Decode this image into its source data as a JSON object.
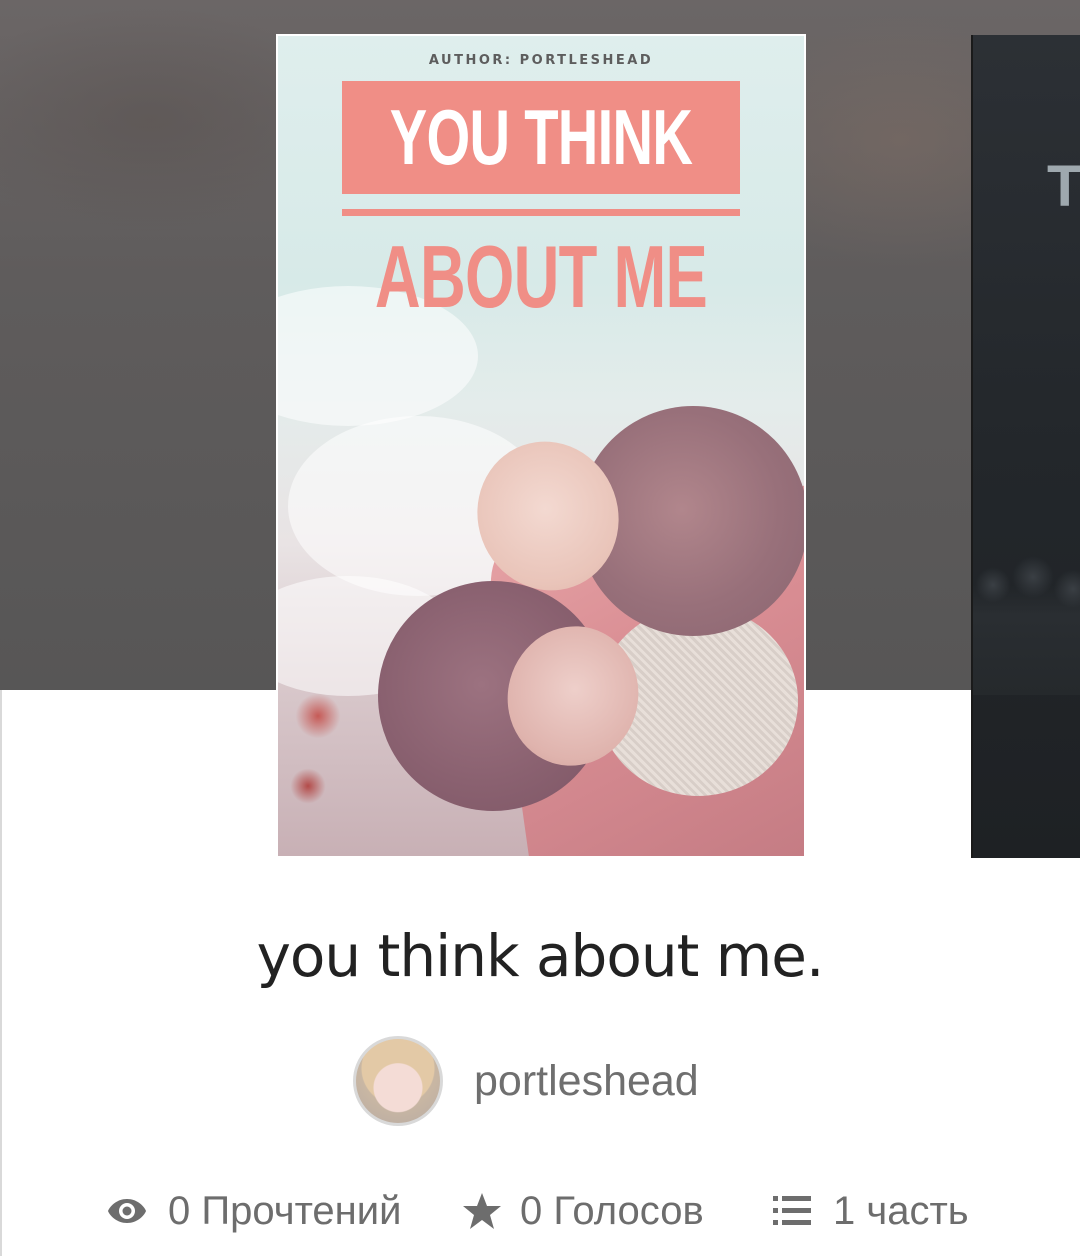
{
  "cover": {
    "author_line": "AUTHOR: PORTLESHEAD",
    "title_line1": "YOU THINK",
    "title_line2": "ABOUT ME",
    "next_cover_letter": "T"
  },
  "story": {
    "title": "you think about me.",
    "author": "portleshead"
  },
  "stats": {
    "reads": "0 Прочтений",
    "votes": "0 Голосов",
    "parts": "1 часть"
  },
  "icons": {
    "reads": "eye-icon",
    "votes": "star-icon",
    "parts": "list-icon"
  },
  "colors": {
    "title_pink": "#f08e86",
    "text_dark": "#222222",
    "text_grey": "#6d6d6d"
  }
}
